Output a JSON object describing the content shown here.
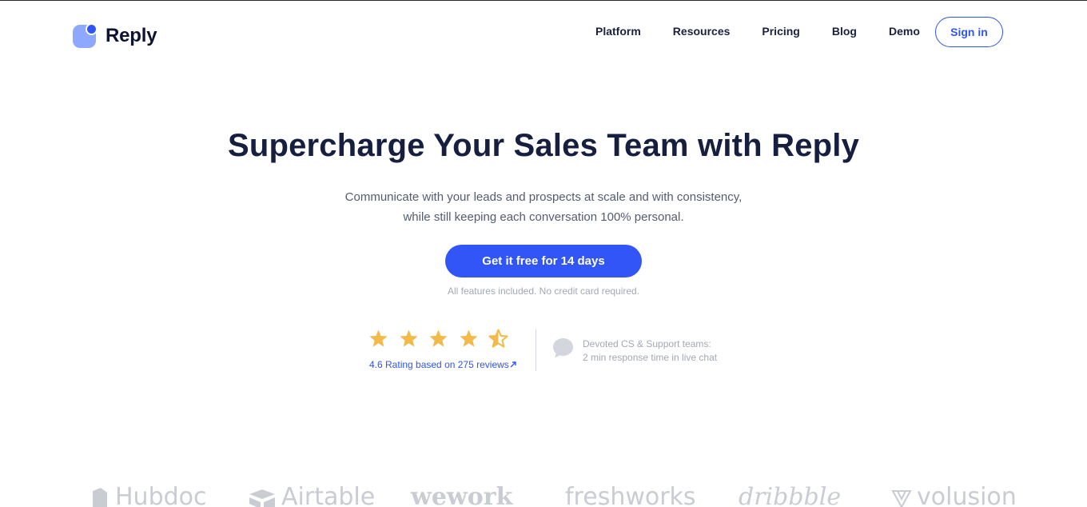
{
  "brand": {
    "name": "Reply"
  },
  "nav": {
    "items": [
      {
        "label": "Platform"
      },
      {
        "label": "Resources"
      },
      {
        "label": "Pricing"
      },
      {
        "label": "Blog"
      },
      {
        "label": "Demo"
      }
    ],
    "signin_label": "Sign in"
  },
  "hero": {
    "title": "Supercharge Your Sales Team with Reply",
    "subtitle_line1": "Communicate with your leads and prospects at scale and with consistency,",
    "subtitle_line2": "while still keeping each conversation 100% personal.",
    "cta_label": "Get it free for 14 days",
    "cta_note": "All features included. No credit card required."
  },
  "rating": {
    "value": 4.6,
    "max": 5,
    "star_color": "#f2b94b",
    "link_text": "4.6 Rating based on 275 reviews",
    "link_icon": "arrow-up-right-icon"
  },
  "support": {
    "icon": "chat-bubble-icon",
    "line1": "Devoted CS & Support teams:",
    "line2": "2 min response time in live chat"
  },
  "client_logos": [
    {
      "name": "Hubdoc"
    },
    {
      "name": "Airtable"
    },
    {
      "name": "wework"
    },
    {
      "name": "freshworks"
    },
    {
      "name": "dribbble"
    },
    {
      "name": "volusion"
    }
  ],
  "colors": {
    "accent": "#3155f6",
    "heading": "#161f3f",
    "muted": "#a3a8b6"
  }
}
